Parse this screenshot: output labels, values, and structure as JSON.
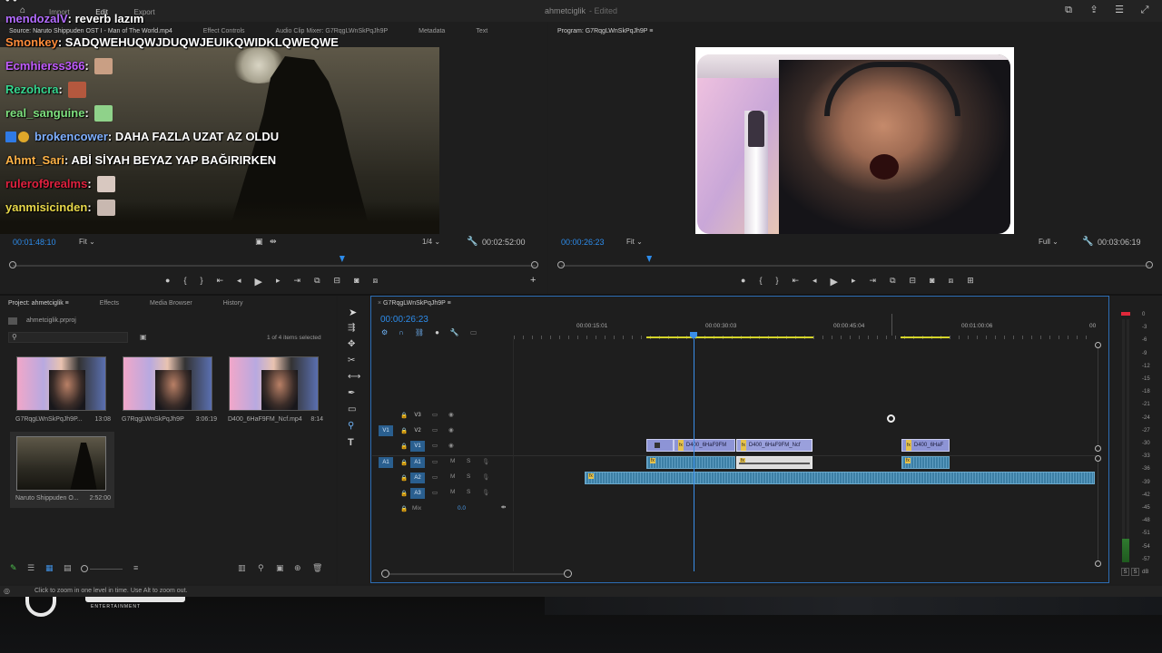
{
  "app": {
    "title": "ahmetciglik",
    "edited": "- Edited",
    "menu": [
      "Import",
      "Edit",
      "Export"
    ],
    "icons": [
      "maximize-icon",
      "share-icon",
      "menu-icon",
      "fullscreen-icon"
    ]
  },
  "chat": {
    "top_partial": "• • ",
    "messages": [
      {
        "user": "mendozalV",
        "color": "#b36cff",
        "text": ": reverb lazım",
        "emote": null
      },
      {
        "user": "Smonkey",
        "color": "#ff8c3a",
        "text": ": SADQWEHUQWJDUQWJEUIKQWIDKLQWEQWE",
        "emote": null
      },
      {
        "user": "Ecmhierss366",
        "color": "#c25cff",
        "text": " :",
        "emote": "#c99f84"
      },
      {
        "user": "Rezohcra",
        "color": "#36d68f",
        "text": " :",
        "emote": "#b4583e"
      },
      {
        "user": "real_sanguine",
        "color": "#7ee07e",
        "text": " :",
        "emote": "#8fd28a"
      },
      {
        "user": "brokencower",
        "color": "#7fb0ff",
        "text": ": DAHA FAZLA UZAT AZ OLDU",
        "emote": null
      },
      {
        "user": "Ahmt_Sari",
        "color": "#ffb347",
        "text": ": ABİ SİYAH BEYAZ YAP BAĞIRIRKEN",
        "emote": null
      },
      {
        "user": "rulerof9realms",
        "color": "#e0213f",
        "text": " :",
        "emote": "#d8c8c0"
      },
      {
        "user": "yanmisicinden",
        "color": "#e8d84a",
        "text": " :",
        "emote": "#c8b8b0"
      }
    ]
  },
  "source": {
    "tabs": [
      "Source: Naruto Shippuden OST I - Man of The World.mp4",
      "Effect Controls",
      "Audio Clip Mixer: G7RqgLWnSkPqJh9P",
      "Metadata",
      "Text"
    ],
    "timecode": "00:01:48:10",
    "fit": "Fit",
    "resolution": "1/4",
    "duration": "00:02:52:00",
    "playhead_fraction": 0.63
  },
  "program": {
    "tab": "Program: G7RqgLWnSkPqJh9P",
    "timecode": "00:00:26:23",
    "fit": "Fit",
    "resolution": "Full",
    "duration": "00:03:06:19",
    "playhead_fraction": 0.15
  },
  "project": {
    "tabs": [
      "Project: ahmetciglik",
      "Effects",
      "Media Browser",
      "History"
    ],
    "file": "ahmetciglik.prproj",
    "search_placeholder": "",
    "selection": "1 of 4 items selected",
    "items": [
      {
        "name": "G7RqgLWnSkPqJh9P...",
        "duration": "13:08",
        "kind": "streamer"
      },
      {
        "name": "G7RqgLWnSkPqJh9P",
        "duration": "3:06:19",
        "kind": "streamer"
      },
      {
        "name": "D400_6HaF9FM_Ncf.mp4",
        "duration": "8:14",
        "kind": "streamer"
      },
      {
        "name": "Naruto Shippuden O...",
        "duration": "2:52:00",
        "kind": "naruto"
      }
    ]
  },
  "timeline": {
    "tab": "G7RqgLWnSkPqJh9P",
    "timecode": "00:00:26:23",
    "ruler": [
      "00:00:15:01",
      "00:00:30:03",
      "00:00:45:04",
      "00:01:00:06",
      "00"
    ],
    "video_tracks": [
      "V3",
      "V2",
      "V1"
    ],
    "audio_tracks": [
      "A1",
      "A2",
      "A3"
    ],
    "source_labels": {
      "video": "V1",
      "audio": "A1"
    },
    "mix_label": "Mix",
    "mix_value": "0.0",
    "solo": "S",
    "mute": "M",
    "clips": [
      {
        "label": "D400_6HaF9FM",
        "fx": "fx"
      },
      {
        "label": "D400_6HaF9FM_Ncf",
        "fx": "fx"
      },
      {
        "label": "D400_6HaF",
        "fx": "fx"
      }
    ]
  },
  "meter": {
    "scale": [
      "0",
      "-3",
      "-6",
      "-9",
      "-12",
      "-15",
      "-18",
      "-21",
      "-24",
      "-27",
      "-30",
      "-33",
      "-36",
      "-39",
      "-42",
      "-45",
      "-48",
      "-51",
      "-54",
      "-57",
      "dB"
    ],
    "solo_left": "S",
    "solo_right": "S"
  },
  "status": {
    "text": "Click to zoom in one level in time. Use Alt to zoom out."
  },
  "brand": {
    "name": "ENTERTAINMENT"
  }
}
